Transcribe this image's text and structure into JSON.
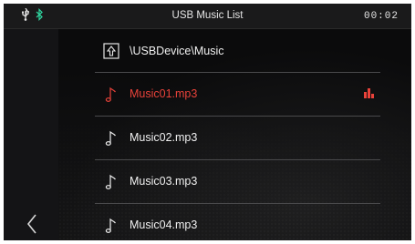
{
  "status_bar": {
    "title": "USB Music List",
    "clock": "00:02",
    "icons": [
      "usb-icon",
      "bluetooth-icon"
    ]
  },
  "colors": {
    "accent": "#e8423a",
    "bluetooth": "#2fd6a0",
    "text": "#f0f0f0",
    "background": "#0b0b0c"
  },
  "list": {
    "folder": {
      "icon": "folder-up-icon",
      "label": "\\USBDevice\\Music"
    },
    "files": [
      {
        "icon": "music-note-icon",
        "label": "Music01.mp3",
        "selected": true,
        "playing_indicator": "equalizer-icon"
      },
      {
        "icon": "music-note-icon",
        "label": "Music02.mp3",
        "selected": false
      },
      {
        "icon": "music-note-icon",
        "label": "Music03.mp3",
        "selected": false
      },
      {
        "icon": "music-note-icon",
        "label": "Music04.mp3",
        "selected": false
      }
    ]
  },
  "navigation": {
    "back_icon": "chevron-left-icon"
  }
}
